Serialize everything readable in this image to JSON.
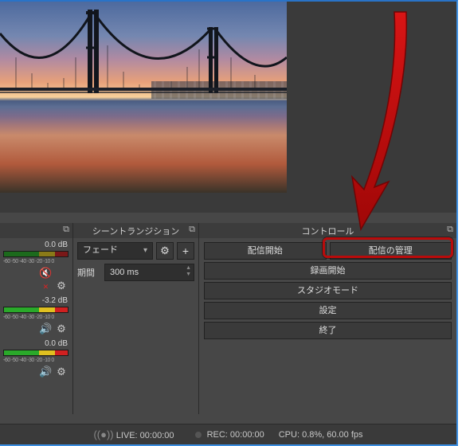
{
  "panels": {
    "transitions_title": "シーントランジション",
    "controls_title": "コントロール"
  },
  "mixer": {
    "ticks": "-60 -50 -40  -30  -20  -10  0",
    "tracks": [
      {
        "db": "0.0 dB",
        "muted": true
      },
      {
        "db": "-3.2 dB",
        "muted": false
      },
      {
        "db": "0.0 dB",
        "muted": false
      }
    ]
  },
  "transitions": {
    "type": "フェード",
    "duration_label": "期間",
    "duration_value": "300 ms"
  },
  "controls": {
    "start_stream": "配信開始",
    "manage_stream": "配信の管理",
    "start_record": "録画開始",
    "studio_mode": "スタジオモード",
    "settings": "設定",
    "exit": "終了"
  },
  "status": {
    "live_label": "LIVE:",
    "live_time": "00:00:00",
    "rec_label": "REC:",
    "rec_time": "00:00:00",
    "cpu": "CPU: 0.8%, 60.00 fps"
  }
}
